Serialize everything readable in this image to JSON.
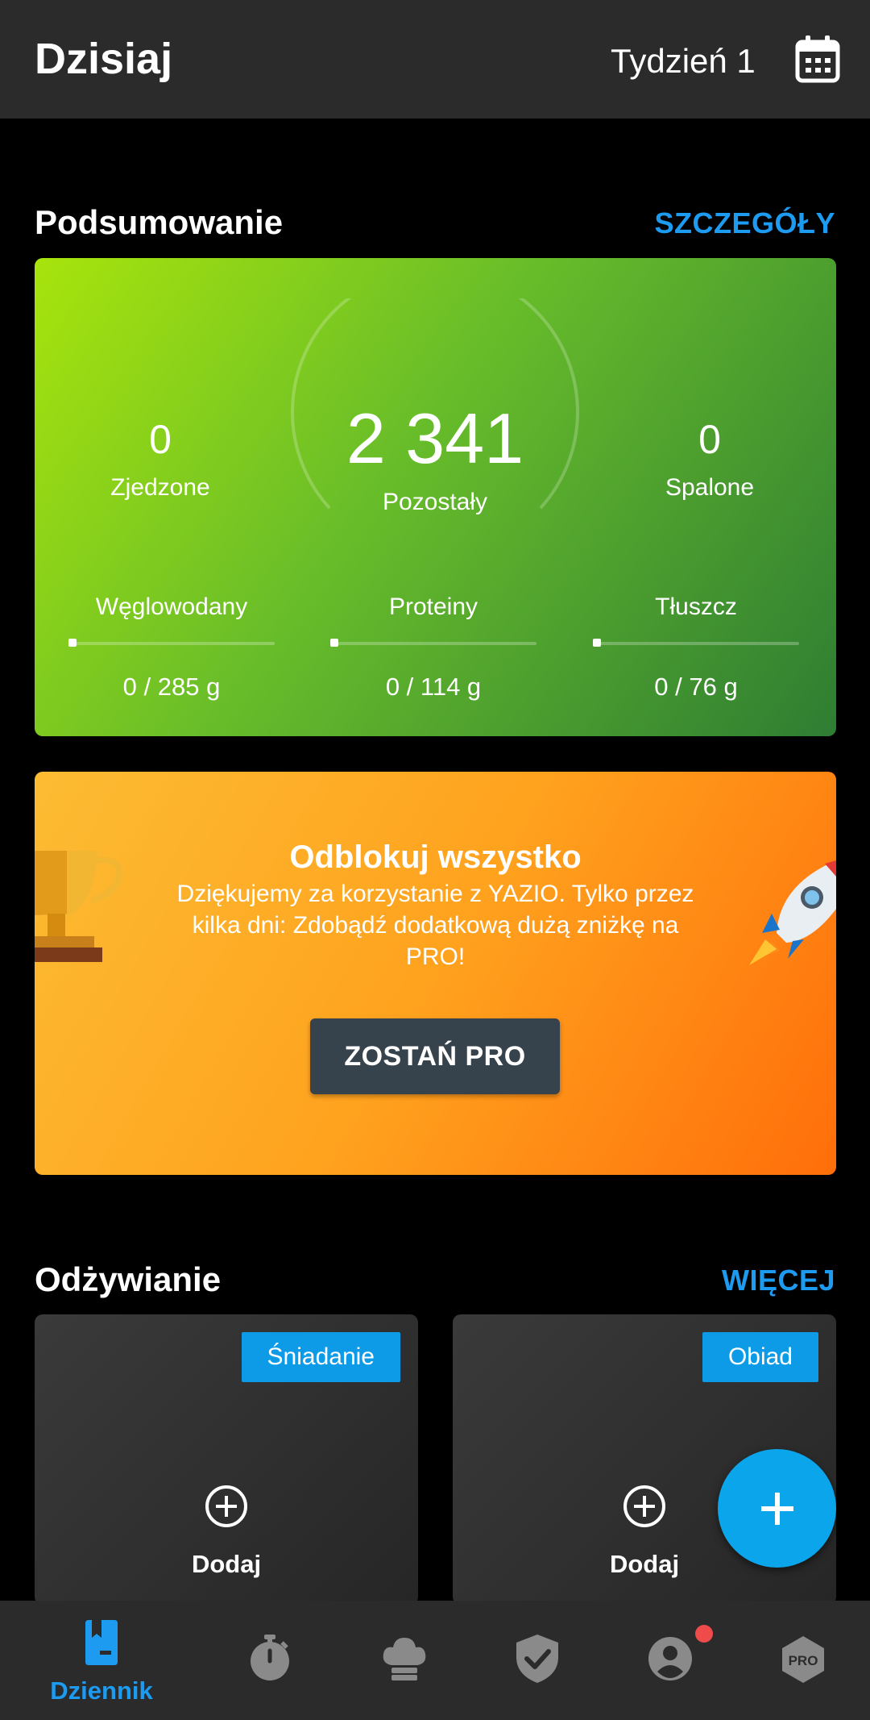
{
  "header": {
    "title": "Dzisiaj",
    "week": "Tydzień 1",
    "calendar_icon": "calendar-icon"
  },
  "summary": {
    "section_title": "Podsumowanie",
    "details_link": "SZCZEGÓŁY",
    "eaten": {
      "value": "0",
      "label": "Zjedzone"
    },
    "remaining": {
      "value": "2 341",
      "label": "Pozostały"
    },
    "burned": {
      "value": "0",
      "label": "Spalone"
    },
    "macros": [
      {
        "name": "Węglowodany",
        "value": "0 / 285 g",
        "progress": 0
      },
      {
        "name": "Proteiny",
        "value": "0 / 114 g",
        "progress": 0
      },
      {
        "name": "Tłuszcz",
        "value": "0 / 76 g",
        "progress": 0
      }
    ],
    "colors": {
      "gradient_start": "#a8e40c",
      "gradient_end": "#2e7d33"
    }
  },
  "promo": {
    "title": "Odblokuj wszystko",
    "text": "Dziękujemy za korzystanie z YAZIO. Tylko przez kilka dni: Zdobądź dodatkową dużą zniżkę na PRO!",
    "button": "ZOSTAŃ PRO",
    "left_icon": "trophy-icon",
    "right_icon": "rocket-icon"
  },
  "nutrition": {
    "section_title": "Odżywianie",
    "more_link": "WIĘCEJ",
    "meals": [
      {
        "tag": "Śniadanie",
        "add_label": "Dodaj"
      },
      {
        "tag": "Obiad",
        "add_label": "Dodaj"
      }
    ]
  },
  "fab": {
    "icon": "plus-icon"
  },
  "bottom_nav": {
    "active_label": "Dziennik",
    "items": [
      "diary-icon",
      "stopwatch-icon",
      "chef-hat-icon",
      "shield-check-icon",
      "profile-icon",
      "pro-icon"
    ],
    "accent": "#1d9bf0"
  }
}
